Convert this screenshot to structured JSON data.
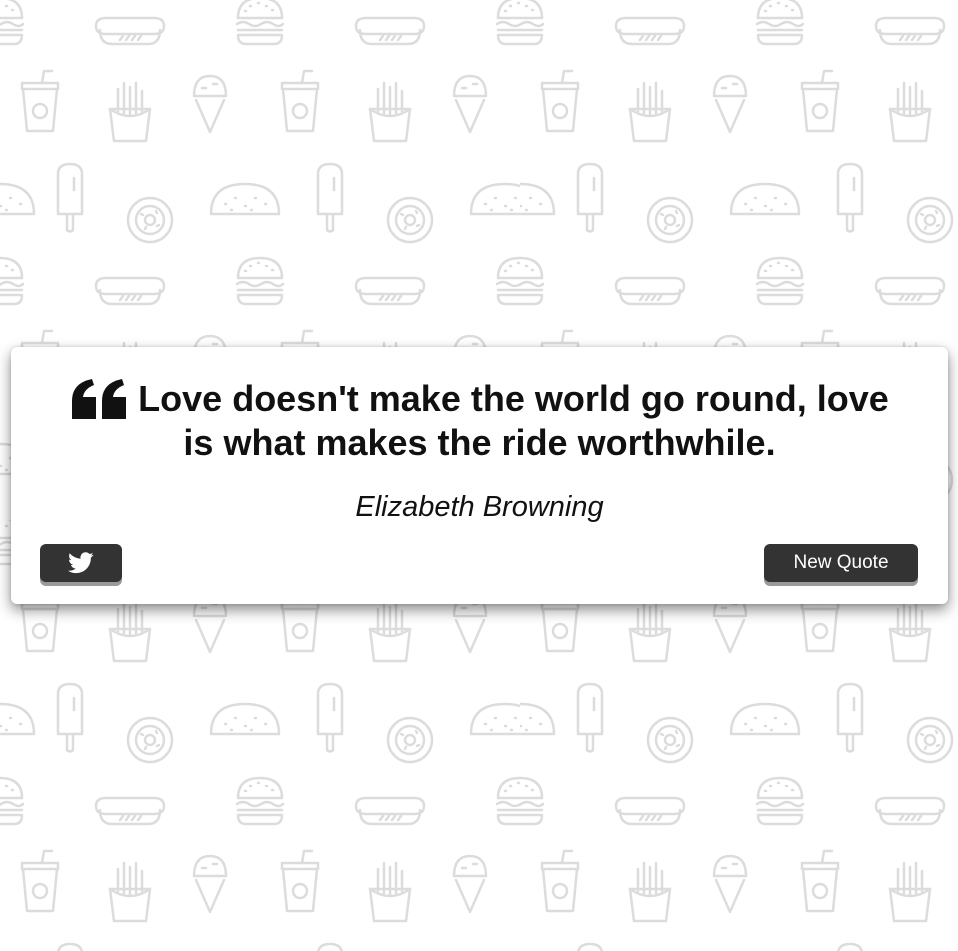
{
  "quote": {
    "text": "Love doesn't make the world go round, love is what makes the ride worthwhile.",
    "author": "Elizabeth Browning",
    "quote_icon": "quote-left-icon"
  },
  "actions": {
    "tweet_icon": "twitter-icon",
    "new_quote_label": "New Quote"
  },
  "background": {
    "pattern": [
      "hamburger-icon",
      "hotdog-icon",
      "soda-cup-icon",
      "ice-cream-cone-icon",
      "french-fries-icon",
      "taco-icon",
      "popsicle-icon",
      "donut-icon"
    ],
    "pattern_color": "#dcdcdc"
  },
  "colors": {
    "page_bg": "#ffffff",
    "card_bg": "#ffffff",
    "button_bg": "#333333",
    "button_text": "#ffffff",
    "text": "#111111"
  }
}
